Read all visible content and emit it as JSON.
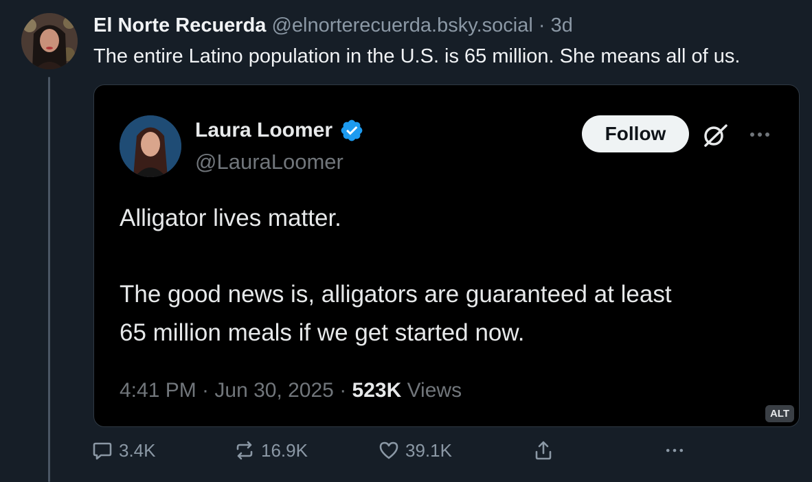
{
  "post": {
    "author_name": "El Norte Recuerda",
    "author_handle": "@elnorterecuerda.bsky.social",
    "separator": "·",
    "time": "3d",
    "text": "The entire Latino population in the U.S. is 65 million. She means all of us."
  },
  "embed": {
    "name": "Laura Loomer",
    "handle": "@LauraLoomer",
    "follow_label": "Follow",
    "text_line1": "Alligator lives matter.",
    "text_line2": "The good news is, alligators are guaranteed at least",
    "text_line3": "65 million meals if we get started now.",
    "timestamp": "4:41 PM · Jun 30, 2025 · ",
    "views_count": "523K",
    "views_label": " Views",
    "alt_label": "ALT"
  },
  "actions": {
    "reply_count": "3.4K",
    "repost_count": "16.9K",
    "like_count": "39.1K"
  },
  "icons": {
    "reply": "reply-icon",
    "repost": "repost-icon",
    "like": "heart-icon",
    "share": "share-icon",
    "more": "more-icon",
    "verified": "verified-badge-icon",
    "grok": "grok-icon"
  },
  "colors": {
    "background": "#161e27",
    "embed_background": "#000000",
    "verified": "#1d9bf0",
    "muted": "#8b98a5"
  }
}
